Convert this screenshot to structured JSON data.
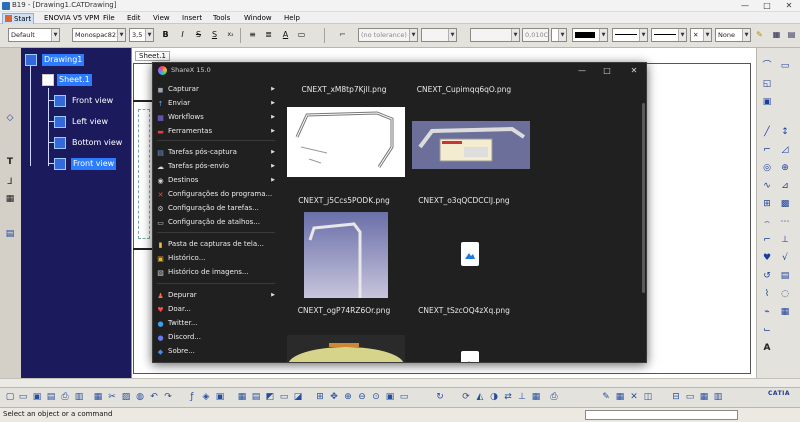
{
  "window": {
    "title": "B19 - [Drawing1.CATDrawing]",
    "minimize": "—",
    "maximize": "□",
    "close": "✕"
  },
  "menubar": {
    "items": [
      "Start",
      "ENOVIA V5 VPM",
      "File",
      "Edit",
      "View",
      "Insert",
      "Tools",
      "Window",
      "Help"
    ]
  },
  "format_toolbar": {
    "style": "Default",
    "font": "Monospac821",
    "size": "3,5",
    "bold": "B",
    "italic": "I",
    "strike": "S",
    "underline": "S",
    "text_color": "A",
    "tolerance": "(no tolerance)",
    "tolerance_value": "0,010C",
    "line_none": "None",
    "cross": "✕"
  },
  "tree": {
    "root": "Drawing1",
    "sheet": "Sheet.1",
    "views": [
      "Front view",
      "Left view",
      "Bottom view",
      "Front view"
    ]
  },
  "sheet_tab": "Sheet.1",
  "sharex": {
    "title": "ShareX 15.0",
    "menu": [
      {
        "label": "Capturar",
        "icon": "camera-icon",
        "glyph": "◼",
        "color": "#9aa6b8",
        "submenu": true
      },
      {
        "label": "Enviar",
        "icon": "upload-icon",
        "glyph": "↑",
        "color": "#4aa3ff",
        "submenu": true
      },
      {
        "label": "Workflows",
        "icon": "workflows-icon",
        "glyph": "▦",
        "color": "#8b6cff",
        "submenu": true
      },
      {
        "label": "Ferramentas",
        "icon": "tools-icon",
        "glyph": "▬",
        "color": "#e04040",
        "submenu": true
      },
      {
        "label": "Tarefas pós-captura",
        "icon": "after-capture-icon",
        "glyph": "▤",
        "color": "#6aa0e0",
        "submenu": true
      },
      {
        "label": "Tarefas pós-envio",
        "icon": "after-upload-icon",
        "glyph": "☁",
        "color": "#cfd8e6",
        "submenu": true
      },
      {
        "label": "Destinos",
        "icon": "destinations-icon",
        "glyph": "◉",
        "color": "#d0d0d0",
        "submenu": true
      },
      {
        "label": "Configurações do programa...",
        "icon": "app-settings-icon",
        "glyph": "✕",
        "color": "#e05050",
        "submenu": false
      },
      {
        "label": "Configuração de tarefas...",
        "icon": "task-settings-icon",
        "glyph": "⚙",
        "color": "#d0d0d0",
        "submenu": false
      },
      {
        "label": "Configuração de atalhos...",
        "icon": "hotkey-settings-icon",
        "glyph": "▭",
        "color": "#d0d0d0",
        "submenu": false
      },
      {
        "label": "Pasta de capturas de tela...",
        "icon": "folder-icon",
        "glyph": "▮",
        "color": "#f0c040",
        "submenu": false
      },
      {
        "label": "Histórico...",
        "icon": "history-icon",
        "glyph": "▣",
        "color": "#f0b030",
        "submenu": false
      },
      {
        "label": "Histórico de imagens...",
        "icon": "image-history-icon",
        "glyph": "▧",
        "color": "#d0d0d0",
        "submenu": false
      },
      {
        "label": "Depurar",
        "icon": "debug-icon",
        "glyph": "♟",
        "color": "#ff6a3a",
        "submenu": true
      },
      {
        "label": "Doar...",
        "icon": "donate-icon",
        "glyph": "♥",
        "color": "#ff4a4a",
        "submenu": false
      },
      {
        "label": "Twitter...",
        "icon": "twitter-icon",
        "glyph": "●",
        "color": "#3aa0f0",
        "submenu": false
      },
      {
        "label": "Discord...",
        "icon": "discord-icon",
        "glyph": "●",
        "color": "#6a78f0",
        "submenu": false
      },
      {
        "label": "Sobre...",
        "icon": "about-icon",
        "glyph": "◆",
        "color": "#4a8ae0",
        "submenu": false
      }
    ],
    "files": [
      "CNEXT_xM8tp7Kjll.png",
      "CNEXT_Cupimqq6qO.png",
      "CNEXT_j5Ccs5PODK.png",
      "CNEXT_o3qQCDCClJ.png",
      "CNEXT_ogP74RZ6Or.png",
      "CNEXT_tSzcOQ4zXq.png"
    ]
  },
  "statusbar": {
    "text": "Select an object or a command"
  },
  "logo": "CATIA"
}
